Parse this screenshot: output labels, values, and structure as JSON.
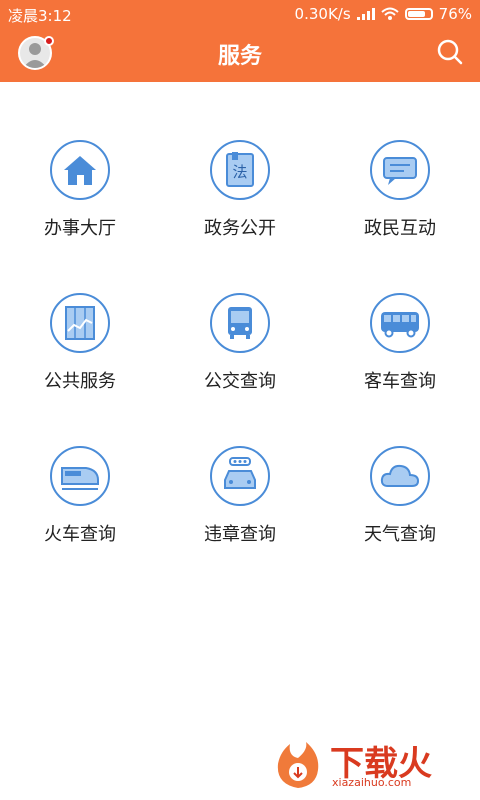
{
  "status_bar": {
    "time": "凌晨3:12",
    "network_speed": "0.30K/s",
    "battery_percent": "76%",
    "battery_level": 0.76
  },
  "header": {
    "title": "服务"
  },
  "services": [
    {
      "label": "办事大厅",
      "icon": "house-icon"
    },
    {
      "label": "政务公开",
      "icon": "law-book-icon"
    },
    {
      "label": "政民互动",
      "icon": "chat-icon"
    },
    {
      "label": "公共服务",
      "icon": "chart-icon"
    },
    {
      "label": "公交查询",
      "icon": "bus-icon"
    },
    {
      "label": "客车查询",
      "icon": "coach-icon"
    },
    {
      "label": "火车查询",
      "icon": "train-icon"
    },
    {
      "label": "违章查询",
      "icon": "car-icon"
    },
    {
      "label": "天气查询",
      "icon": "cloud-icon"
    }
  ],
  "law_icon_char": "法",
  "watermark": {
    "name": "下载火",
    "url": "xiazaihuo.com"
  },
  "colors": {
    "header": "#f5733a",
    "icon_blue": "#4a8cd8",
    "icon_fill": "#a9ccf2"
  }
}
